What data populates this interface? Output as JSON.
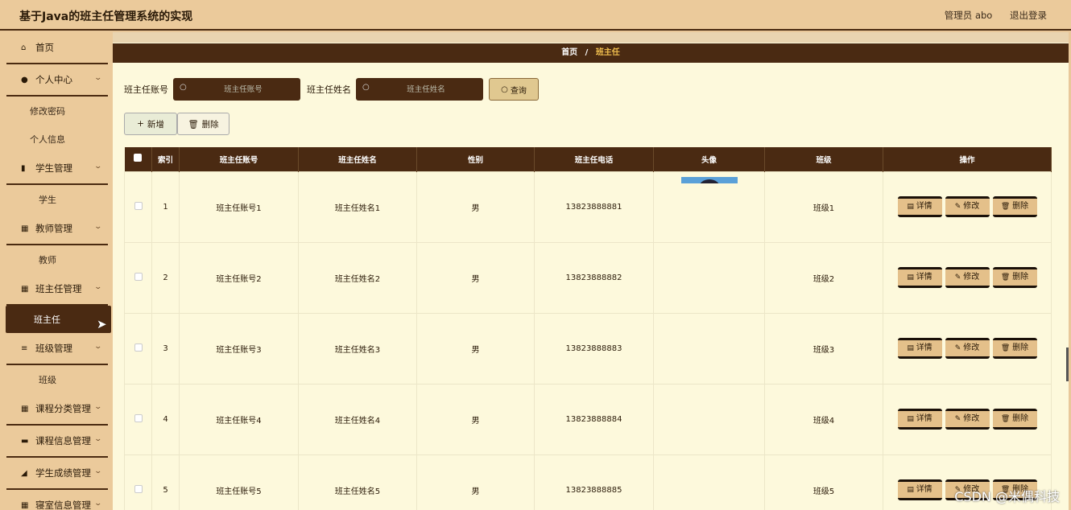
{
  "header": {
    "title": "基于Java的班主任管理系统的实现",
    "user": "管理员 abo",
    "logout": "退出登录"
  },
  "sidebar": {
    "items": [
      {
        "type": "menu",
        "icon": "home-icon",
        "glyph": "⌂",
        "label": "首页",
        "chev": false
      },
      {
        "type": "menu",
        "icon": "user-icon",
        "glyph": "●",
        "label": "个人中心",
        "chev": true
      },
      {
        "type": "sub",
        "label": "修改密码"
      },
      {
        "type": "sub",
        "label": "个人信息"
      },
      {
        "type": "menu",
        "icon": "chart-icon",
        "glyph": "▮",
        "label": "学生管理",
        "chev": true
      },
      {
        "type": "sub",
        "label": "学生",
        "center": true
      },
      {
        "type": "menu",
        "icon": "grid-icon",
        "glyph": "▦",
        "label": "教师管理",
        "chev": true
      },
      {
        "type": "sub",
        "label": "教师",
        "center": true
      },
      {
        "type": "menu",
        "icon": "grid-icon",
        "glyph": "▦",
        "label": "班主任管理",
        "chev": true
      },
      {
        "type": "sub",
        "label": "班主任",
        "active": true
      },
      {
        "type": "menu",
        "icon": "list-icon",
        "glyph": "≡",
        "label": "班级管理",
        "chev": true
      },
      {
        "type": "sub",
        "label": "班级",
        "center": true
      },
      {
        "type": "menu",
        "icon": "grid-icon",
        "glyph": "▦",
        "label": "课程分类管理",
        "chev": true
      },
      {
        "type": "menu",
        "icon": "briefcase-icon",
        "glyph": "▬",
        "label": "课程信息管理",
        "chev": true
      },
      {
        "type": "menu",
        "icon": "graduation-icon",
        "glyph": "◢",
        "label": "学生成绩管理",
        "chev": true
      },
      {
        "type": "menu",
        "icon": "grid-icon",
        "glyph": "▦",
        "label": "寝室信息管理",
        "chev": true
      }
    ]
  },
  "breadcrumb": {
    "home": "首页",
    "sep": "/",
    "current": "班主任"
  },
  "search": {
    "label1": "班主任账号",
    "placeholder1": "班主任账号",
    "label2": "班主任姓名",
    "placeholder2": "班主任姓名",
    "query": "查询"
  },
  "actions": {
    "add": "新增",
    "delete": "删除"
  },
  "table": {
    "headers": [
      "",
      "索引",
      "班主任账号",
      "班主任姓名",
      "性别",
      "班主任电话",
      "头像",
      "班级",
      "操作"
    ],
    "rows": [
      {
        "index": "1",
        "account": "班主任账号1",
        "name": "班主任姓名1",
        "gender": "男",
        "phone": "13823888881",
        "klass": "班级1",
        "avatar": true
      },
      {
        "index": "2",
        "account": "班主任账号2",
        "name": "班主任姓名2",
        "gender": "男",
        "phone": "13823888882",
        "klass": "班级2",
        "avatar": false
      },
      {
        "index": "3",
        "account": "班主任账号3",
        "name": "班主任姓名3",
        "gender": "男",
        "phone": "13823888883",
        "klass": "班级3",
        "avatar": false
      },
      {
        "index": "4",
        "account": "班主任账号4",
        "name": "班主任姓名4",
        "gender": "男",
        "phone": "13823888884",
        "klass": "班级4",
        "avatar": false
      },
      {
        "index": "5",
        "account": "班主任账号5",
        "name": "班主任姓名5",
        "gender": "男",
        "phone": "13823888885",
        "klass": "班级5",
        "avatar": false
      }
    ],
    "ops": {
      "detail": "详情",
      "edit": "修改",
      "remove": "删除"
    }
  },
  "watermark": "CSDN @米偶科技",
  "colors": {
    "accent": "#4a2a12",
    "sidebar": "#ebca9b",
    "content": "#fdf9dc",
    "highlight": "#f2c04f"
  }
}
